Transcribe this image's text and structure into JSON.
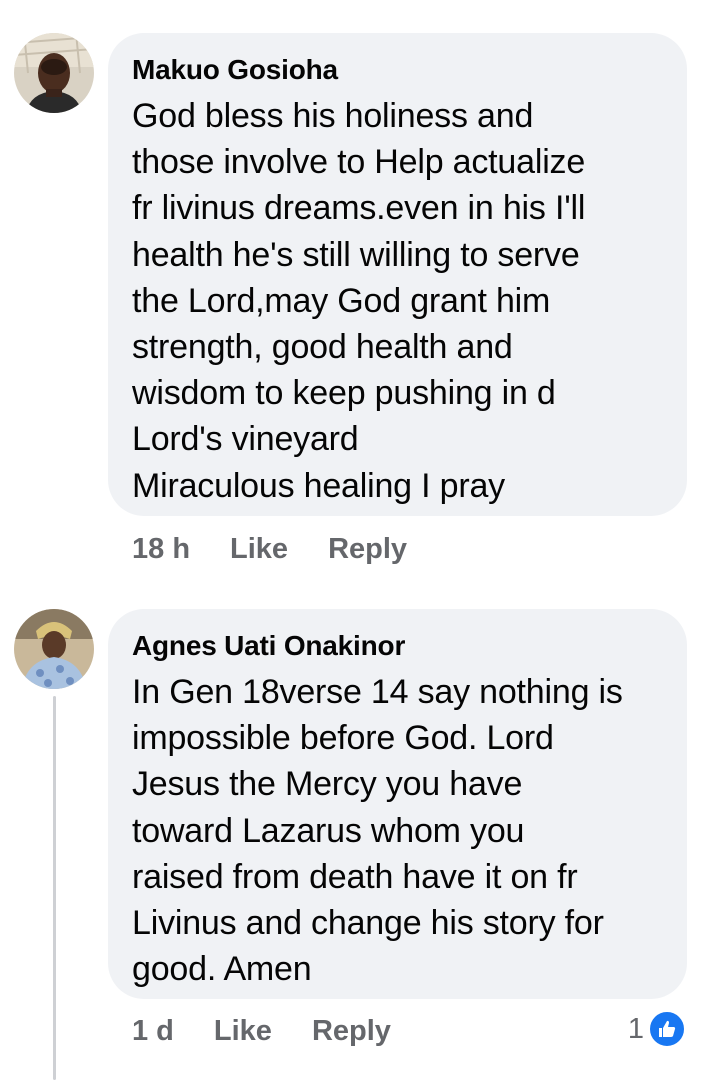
{
  "comments": [
    {
      "author": "Makuo Gosioha",
      "text": "God bless his holiness and\nthose involve to Help actualize\nfr livinus dreams.even in his I'll\nhealth he's still willing to serve\nthe Lord,may God grant him\nstrength, good health and\nwisdom to keep pushing in d\nLord's vineyard\nMiraculous healing I pray",
      "time": "18 h",
      "like_label": "Like",
      "reply_label": "Reply"
    },
    {
      "author": "Agnes Uati Onakinor",
      "text": "In Gen 18verse 14 say nothing is\nimpossible before God. Lord\nJesus the Mercy you have\ntoward Lazarus whom you\nraised from death have it on fr\nLivinus and change his story for\ngood. Amen",
      "time": "1 d",
      "like_label": "Like",
      "reply_label": "Reply",
      "reaction_count": "1"
    }
  ],
  "colors": {
    "bubble": "#f0f2f5",
    "meta": "#65676b",
    "like_blue": "#1877f2"
  },
  "icons": [
    "avatar-photo",
    "thumbs-up-icon"
  ]
}
